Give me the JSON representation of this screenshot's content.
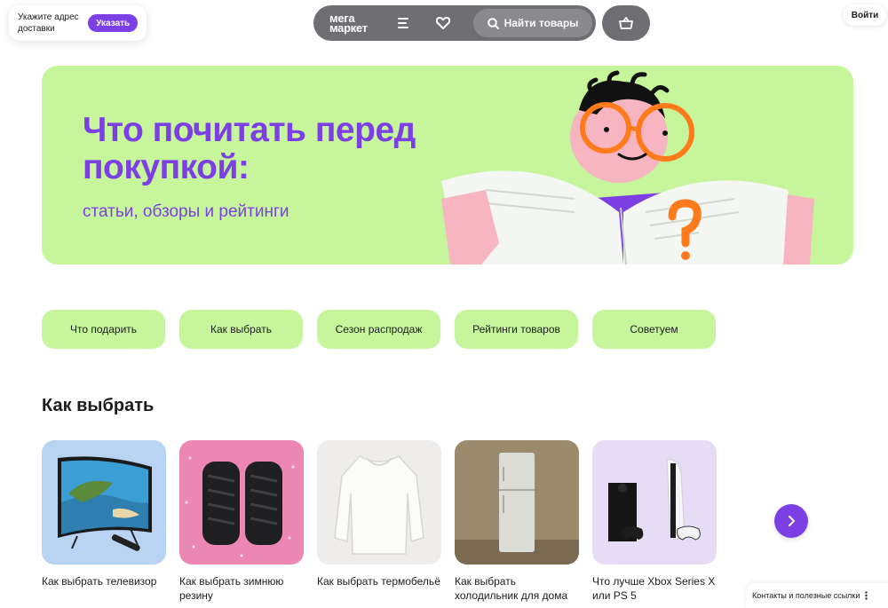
{
  "delivery": {
    "text": "Укажите адрес доставки",
    "button": "Указать"
  },
  "header": {
    "logo_line1": "мега",
    "logo_line2": "маркет",
    "search_label": "Найти товары",
    "login_label": "Войти"
  },
  "hero": {
    "title": "Что почитать перед покупкой:",
    "subtitle": "статьи, обзоры и рейтинги"
  },
  "chips": [
    "Что подарить",
    "Как выбрать",
    "Сезон распродаж",
    "Рейтинги товаров",
    "Советуем"
  ],
  "section": {
    "title": "Как выбрать"
  },
  "cards": [
    {
      "title": "Как выбрать телевизор"
    },
    {
      "title": "Как выбрать зимнюю резину"
    },
    {
      "title": "Как выбрать термобельё"
    },
    {
      "title": "Как выбрать холодильник для дома"
    },
    {
      "title": "Что лучше Xbox Series X или PS 5"
    }
  ],
  "footer": {
    "links_label": "Контакты и полезные ссылки"
  },
  "colors": {
    "accent": "#7b3fe4",
    "mint": "#c6f59c",
    "header_bg": "#6f6f73"
  }
}
